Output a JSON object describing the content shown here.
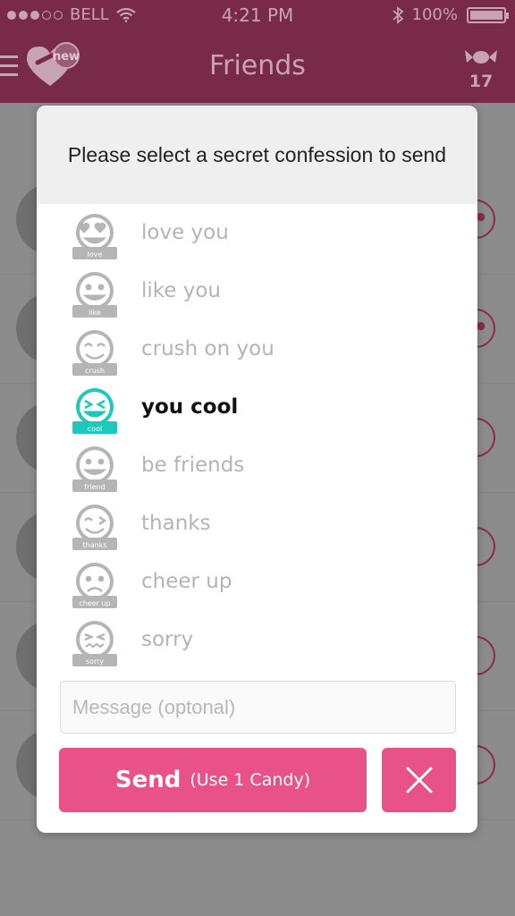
{
  "status_bar": {
    "carrier": "BELL",
    "time": "4:21 PM",
    "battery": "100%"
  },
  "nav": {
    "title": "Friends",
    "logo_badge": "new",
    "candy_count": "17"
  },
  "dialog": {
    "title": "Please select a secret confession to send",
    "options": [
      {
        "label": "love you",
        "icon_label": "love",
        "selected": false
      },
      {
        "label": "like you",
        "icon_label": "like",
        "selected": false
      },
      {
        "label": "crush on you",
        "icon_label": "crush",
        "selected": false
      },
      {
        "label": "you cool",
        "icon_label": "cool",
        "selected": true
      },
      {
        "label": "be friends",
        "icon_label": "friend",
        "selected": false
      },
      {
        "label": "thanks",
        "icon_label": "thanks",
        "selected": false
      },
      {
        "label": "cheer up",
        "icon_label": "cheer up",
        "selected": false
      },
      {
        "label": "sorry",
        "icon_label": "sorry",
        "selected": false
      }
    ],
    "message_placeholder": "Message (optonal)",
    "send_label": "Send",
    "send_sublabel": "(Use 1 Candy)"
  },
  "colors": {
    "accent": "#e95189",
    "selected": "#1ec8bd",
    "unselected_icon": "#b5b5b5"
  }
}
